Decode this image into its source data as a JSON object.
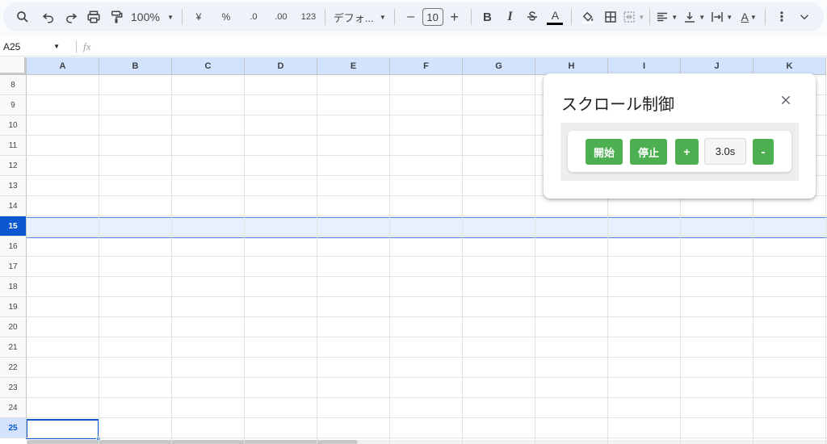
{
  "toolbar": {
    "zoom": "100%",
    "currency": "¥",
    "percent": "%",
    "decrease_decimal": ".0",
    "increase_decimal": ".00",
    "number_format": "123",
    "font_family": "デフォ...",
    "font_size": "10",
    "minus": "–",
    "plus": "+",
    "bold": "B",
    "italic": "I",
    "text_color": "A",
    "text_rotate": "A"
  },
  "formula_bar": {
    "name_box": "A25",
    "fx": "fx"
  },
  "columns": [
    "A",
    "B",
    "C",
    "D",
    "E",
    "F",
    "G",
    "H",
    "I",
    "J",
    "K"
  ],
  "rows": [
    "8",
    "9",
    "10",
    "11",
    "12",
    "13",
    "14",
    "15",
    "16",
    "17",
    "18",
    "19",
    "20",
    "21",
    "22",
    "23",
    "24",
    "25"
  ],
  "selected_row": "15",
  "active_cell": "A25",
  "dialog": {
    "title": "スクロール制御",
    "start_label": "開始",
    "stop_label": "停止",
    "plus_label": "+",
    "speed_value": "3.0s",
    "minus_label": "-"
  },
  "colors": {
    "accent": "#0b57d0",
    "button_green": "#4caf50",
    "header_blue": "#d3e3fd"
  }
}
